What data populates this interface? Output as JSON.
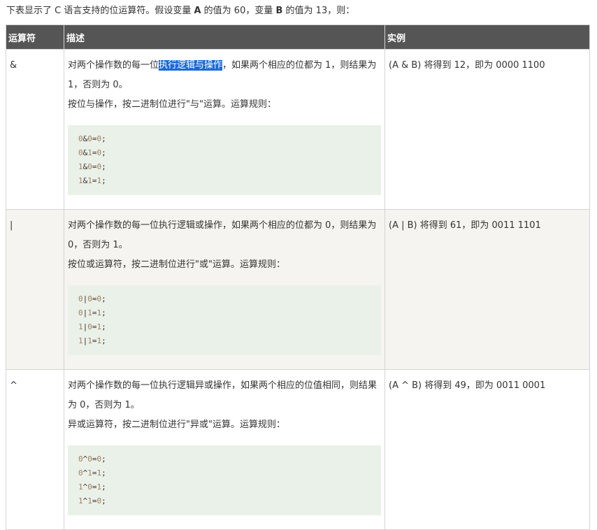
{
  "intro": {
    "part1": "下表显示了 C 语言支持的位运算符。假设变量 ",
    "var_a": "A",
    "part2": " 的值为 60，变量 ",
    "var_b": "B",
    "part3": " 的值为 13，则："
  },
  "table": {
    "headers": [
      "运算符",
      "描述",
      "实例"
    ],
    "rows": [
      {
        "op": "&",
        "desc_before_highlight": "对两个操作数的每一位",
        "desc_highlight": "执行逻辑与操作",
        "desc_after_highlight": "，如果两个相应的位都为 1，则结果为 1，否则为 0。",
        "desc_line2": "按位与操作，按二进制位进行\"与\"运算。运算规则：",
        "code": [
          {
            "a": "0",
            "op": "&",
            "b": "0",
            "r": "0"
          },
          {
            "a": "0",
            "op": "&",
            "b": "1",
            "r": "0"
          },
          {
            "a": "1",
            "op": "&",
            "b": "0",
            "r": "0"
          },
          {
            "a": "1",
            "op": "&",
            "b": "1",
            "r": "1"
          }
        ],
        "example": "(A & B) 将得到 12，即为 0000 1100"
      },
      {
        "op": "|",
        "desc_before_highlight": "对两个操作数的每一位执行逻辑或操作，如果两个相应的位都为 0，则结果为 0，否则为 1。",
        "desc_highlight": "",
        "desc_after_highlight": "",
        "desc_line2": "按位或运算符，按二进制位进行\"或\"运算。运算规则：",
        "code": [
          {
            "a": "0",
            "op": "|",
            "b": "0",
            "r": "0"
          },
          {
            "a": "0",
            "op": "|",
            "b": "1",
            "r": "1"
          },
          {
            "a": "1",
            "op": "|",
            "b": "0",
            "r": "1"
          },
          {
            "a": "1",
            "op": "|",
            "b": "1",
            "r": "1"
          }
        ],
        "example": "(A | B) 将得到 61，即为 0011 1101"
      },
      {
        "op": "^",
        "desc_before_highlight": "对两个操作数的每一位执行逻辑异或操作，如果两个相应的位值相同，则结果为 0，否则为 1。",
        "desc_highlight": "",
        "desc_after_highlight": "",
        "desc_line2": "异或运算符，按二进制位进行\"异或\"运算。运算规则：",
        "code": [
          {
            "a": "0",
            "op": "^",
            "b": "0",
            "r": "0"
          },
          {
            "a": "0",
            "op": "^",
            "b": "1",
            "r": "1"
          },
          {
            "a": "1",
            "op": "^",
            "b": "0",
            "r": "1"
          },
          {
            "a": "1",
            "op": "^",
            "b": "1",
            "r": "0"
          }
        ],
        "example": "(A ^ B) 将得到 49，即为 0011 0001"
      }
    ]
  },
  "colors": {
    "header_bg": "#555555",
    "header_text": "#ffffff",
    "code_bg": "#e9f1e9",
    "alt_row_bg": "#f6f4f0",
    "highlight_bg": "#1c69d4",
    "number_color": "#a67f59"
  }
}
